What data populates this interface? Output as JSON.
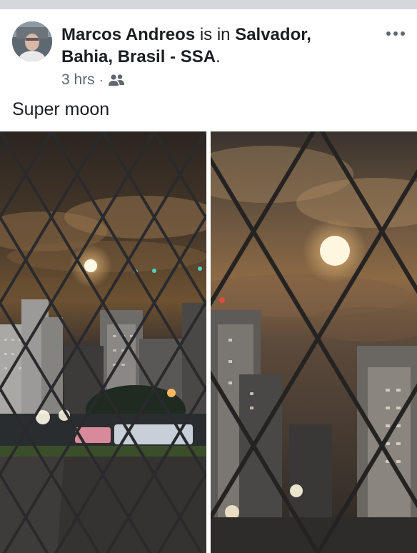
{
  "post": {
    "author": "Marcos Andreos",
    "is_in": " is in ",
    "location": "Salvador, Bahia, Brasil - SSA",
    "period": ".",
    "time": "3 hrs",
    "separator": "·",
    "audience_icon": "friends-icon",
    "caption": "Super moon"
  },
  "icons": {
    "more": "more-options-icon",
    "avatar": "profile-photo"
  },
  "photos": [
    {
      "name": "photo-left",
      "content": "night skyline with moon through diamond window grille"
    },
    {
      "name": "photo-right",
      "content": "zoomed moon over city through diamond window grille"
    }
  ],
  "colors": {
    "text": "#1c1e21",
    "meta": "#606770",
    "top_bar": "#d5d7dc"
  }
}
